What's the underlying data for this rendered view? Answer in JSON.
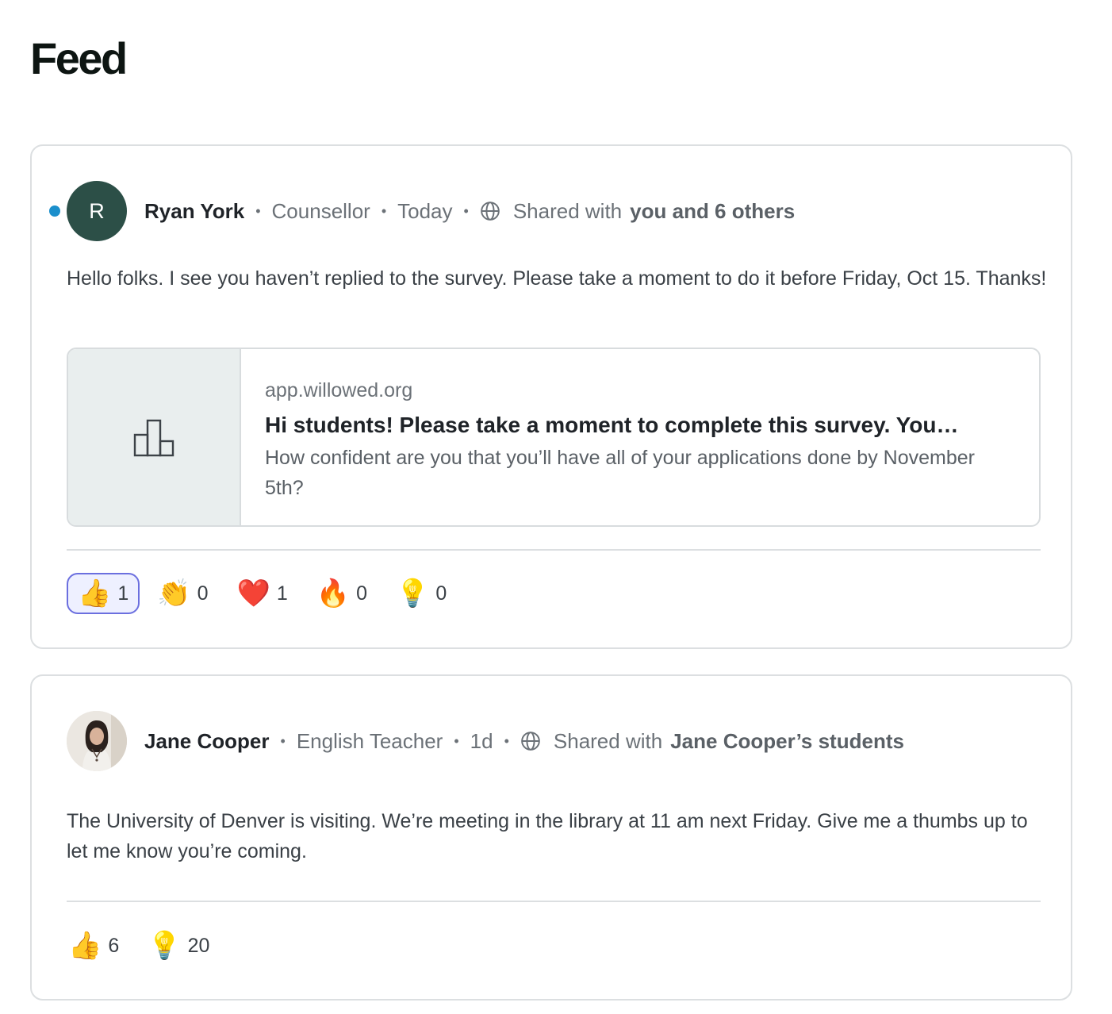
{
  "page": {
    "title": "Feed"
  },
  "posts": [
    {
      "author": "Ryan York",
      "avatar_initial": "R",
      "role": "Counsellor",
      "time": "Today",
      "shared_prefix": "Shared with",
      "shared_target": "you and 6 others",
      "unread": true,
      "body": "Hello folks. I see you haven’t replied to the survey. Please take a moment to do it before Friday, Oct 15. Thanks!",
      "link_preview": {
        "domain": "app.willowed.org",
        "title": "Hi students! Please take a moment to complete this survey. You…",
        "description": "How confident are you that you’ll have all of your applications done by November 5th?",
        "icon": "bar-chart-icon"
      },
      "reactions": [
        {
          "emoji": "👍",
          "name": "thumbs-up",
          "count": "1",
          "active": true
        },
        {
          "emoji": "👏",
          "name": "clapping-hands",
          "count": "0",
          "active": false
        },
        {
          "emoji": "❤️",
          "name": "red-heart",
          "count": "1",
          "active": false
        },
        {
          "emoji": "🔥",
          "name": "fire",
          "count": "0",
          "active": false
        },
        {
          "emoji": "💡",
          "name": "light-bulb",
          "count": "0",
          "active": false
        }
      ]
    },
    {
      "author": "Jane Cooper",
      "role": "English Teacher",
      "time": "1d",
      "shared_prefix": "Shared with",
      "shared_target": "Jane Cooper’s students",
      "unread": false,
      "body": "The University of Denver is visiting. We’re meeting in the library at 11 am next Friday. Give me a thumbs up to let me know you’re coming.",
      "reactions": [
        {
          "emoji": "👍",
          "name": "thumbs-up",
          "count": "6",
          "active": false
        },
        {
          "emoji": "💡",
          "name": "light-bulb",
          "count": "20",
          "active": false
        }
      ]
    }
  ],
  "colors": {
    "avatar_bg": "#2c4f47",
    "unread_dot": "#1b8fcc",
    "active_reaction_border": "#6b6fdf"
  }
}
